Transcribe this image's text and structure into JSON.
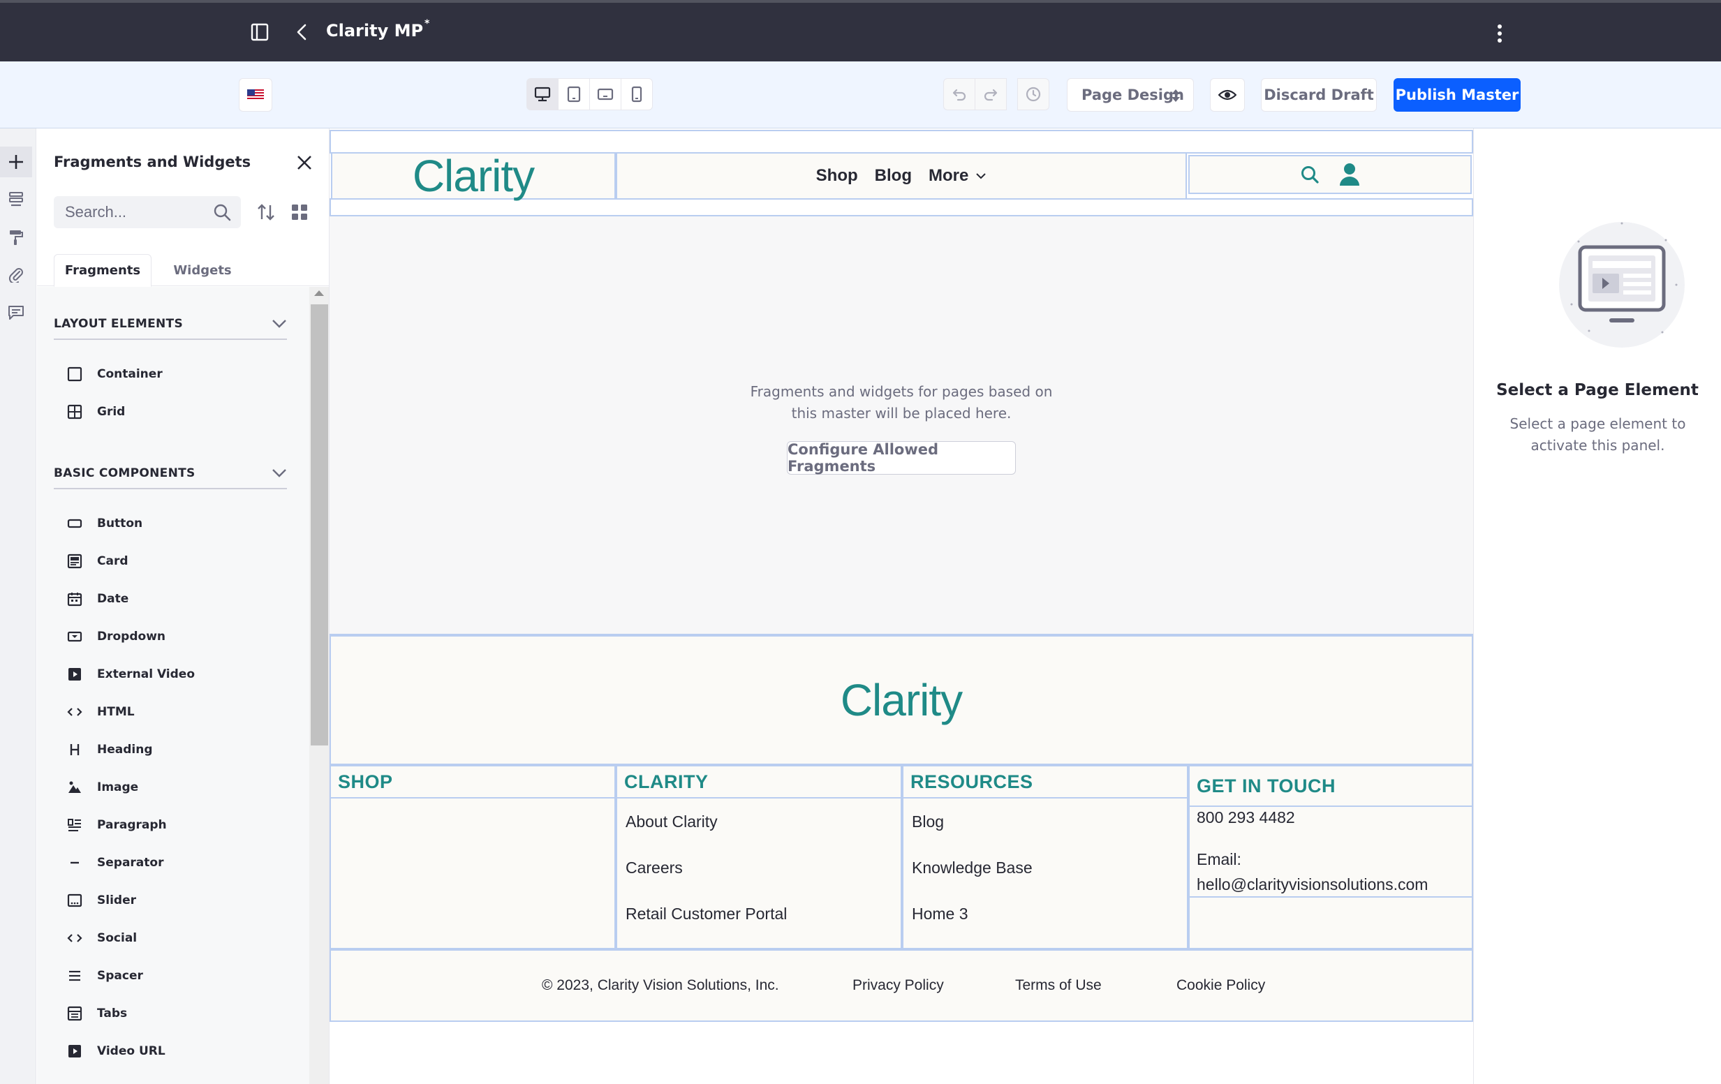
{
  "topbar": {
    "title": "Clarity MP",
    "unsaved_marker": "*"
  },
  "toolbar": {
    "language_flag": "en-US flag",
    "page_design_label": "Page Design",
    "discard_label": "Discard Draft",
    "publish_label": "Publish Master"
  },
  "panel": {
    "title": "Fragments and Widgets",
    "search_placeholder": "Search...",
    "tabs": {
      "fragments": "Fragments",
      "widgets": "Widgets"
    },
    "layout_elements": {
      "title": "LAYOUT ELEMENTS",
      "items": [
        "Container",
        "Grid"
      ]
    },
    "basic_components": {
      "title": "BASIC COMPONENTS",
      "items": [
        "Button",
        "Card",
        "Date",
        "Dropdown",
        "External Video",
        "HTML",
        "Heading",
        "Image",
        "Paragraph",
        "Separator",
        "Slider",
        "Social",
        "Spacer",
        "Tabs",
        "Video URL"
      ]
    }
  },
  "canvas": {
    "logo": "Clarity",
    "nav": {
      "shop": "Shop",
      "blog": "Blog",
      "more": "More"
    },
    "drop_zone_message": "Fragments and widgets for pages based on this master will be placed here.",
    "configure_label": "Configure Allowed Fragments",
    "footer_logo": "Clarity",
    "footer": {
      "shop": {
        "title": "SHOP"
      },
      "clarity": {
        "title": "CLARITY",
        "links": [
          "About Clarity",
          "Careers",
          "Retail Customer Portal"
        ]
      },
      "resources": {
        "title": "RESOURCES",
        "links": [
          "Blog",
          "Knowledge Base",
          "Home 3"
        ]
      },
      "contact": {
        "title": "GET IN TOUCH",
        "phone": "800 293 4482",
        "email_label": "Email:",
        "email": "hello@clarityvisionsolutions.com"
      }
    },
    "legal": {
      "copyright": "© 2023, Clarity Vision Solutions, Inc.",
      "privacy": "Privacy Policy",
      "terms": "Terms of Use",
      "cookie": "Cookie Policy"
    }
  },
  "right_panel": {
    "title": "Select a Page Element",
    "description": "Select a page element to activate this panel."
  },
  "colors": {
    "topbar_bg": "#30313f",
    "toolbar_bg": "#eff5ff",
    "primary": "#0b5fff",
    "brand_teal": "#1f8a87",
    "fragment_outline": "#b9cdf0"
  }
}
